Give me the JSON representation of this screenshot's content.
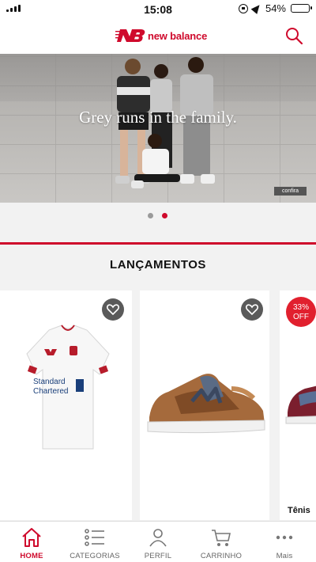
{
  "status_bar": {
    "time": "15:08",
    "battery": "54%",
    "battery_level": 0.54
  },
  "header": {
    "brand": "new balance",
    "icons": [
      "nb-logo-icon",
      "search-icon"
    ]
  },
  "hero": {
    "headline": "Grey runs in the family.",
    "cta": "confira"
  },
  "carousel": {
    "slides": 2,
    "active_slide": 2
  },
  "section": {
    "title": "LANÇAMENTOS"
  },
  "products": [
    {
      "kind": "Liverpool away jersey",
      "sponsor_line_1": "Standard",
      "sponsor_line_2": "Chartered",
      "favorite_icon": "heart-outline-icon"
    },
    {
      "kind": "brown sneaker",
      "favorite_icon": "heart-outline-icon"
    },
    {
      "kind": "burgundy sneaker",
      "discount": "33%",
      "discount_suffix": "OFF",
      "name": "Tênis"
    }
  ],
  "tabs": [
    {
      "label": "HOME",
      "icon": "home-icon",
      "active": true
    },
    {
      "label": "CATEGORIAS",
      "icon": "list-icon",
      "active": false
    },
    {
      "label": "PERFIL",
      "icon": "person-icon",
      "active": false
    },
    {
      "label": "CARRINHO",
      "icon": "cart-icon",
      "active": false
    },
    {
      "label": "Mais",
      "icon": "more-icon",
      "active": false
    }
  ],
  "colors": {
    "brand_red": "#cf0a2c",
    "badge_red": "#e1202e"
  }
}
